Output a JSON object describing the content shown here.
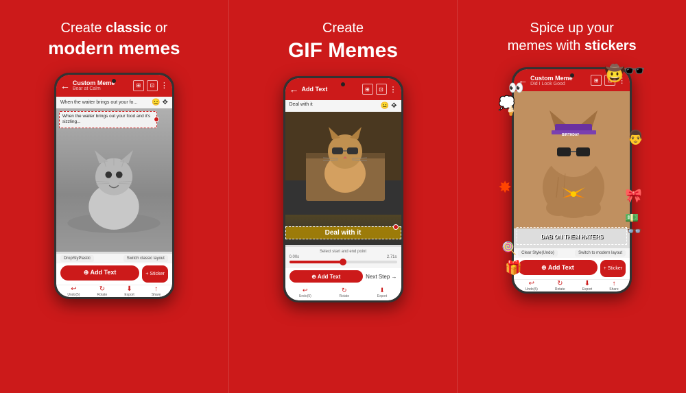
{
  "panels": [
    {
      "id": "panel-1",
      "headline_part1": "Create ",
      "headline_bold": "classic",
      "headline_part2": " or",
      "headline_bold2": "modern memes",
      "phone": {
        "topbar_title": "Custom Meme",
        "topbar_subtitle": "Bear at Calm",
        "meme_top_text": "When the waiter brings out your fo...",
        "meme_overlay_text": "When the waiter brings out your food and it's sizzling...",
        "add_text_label": "⊕ Add Text",
        "layout_btn1": "DropStyPlastic",
        "layout_btn2": "Switch classic layout",
        "nav_items": [
          "Undo(5)",
          "Rotate",
          "Export",
          "Share"
        ]
      }
    },
    {
      "id": "panel-2",
      "headline_part1": "Create",
      "headline_bold": "GIF Memes",
      "phone": {
        "topbar_title": "Add Text",
        "meme_top_text": "Deal with it",
        "deal_text": "Deal with it",
        "select_text": "Select start and end point",
        "time_start": "0.00s",
        "time_end": "2.71s",
        "add_text_label": "⊕ Add Text",
        "next_step": "Next Step →",
        "nav_items": [
          "Undo(5)",
          "Rotate",
          "Export"
        ]
      }
    },
    {
      "id": "panel-3",
      "headline_part1": "Spice up your",
      "headline_part2": "memes with ",
      "headline_bold": "stickers",
      "phone": {
        "topbar_title": "Custom Meme",
        "topbar_subtitle": "Did I Look Good",
        "dab_text": "DAB ON THEM HATERS",
        "add_text_label": "⊕ Add Text",
        "sticker_btn": "+ Sticker",
        "layout_btn1": "Clear Style(Undo)",
        "layout_btn2": "Switch to modern layout",
        "nav_items": [
          "Undo(5)",
          "Rotate",
          "Export",
          "Share"
        ]
      }
    }
  ],
  "icons": {
    "back_arrow": "←",
    "add_icon": "⊕",
    "share_icon": "↑",
    "undo_label": "Undo(5)",
    "rotate_label": "Rotate",
    "export_label": "Export",
    "share_label": "Share",
    "next_arrow": "→"
  },
  "colors": {
    "primary_red": "#cc1a1a",
    "dark": "#111111",
    "phone_bg": "#f0f0f0"
  }
}
